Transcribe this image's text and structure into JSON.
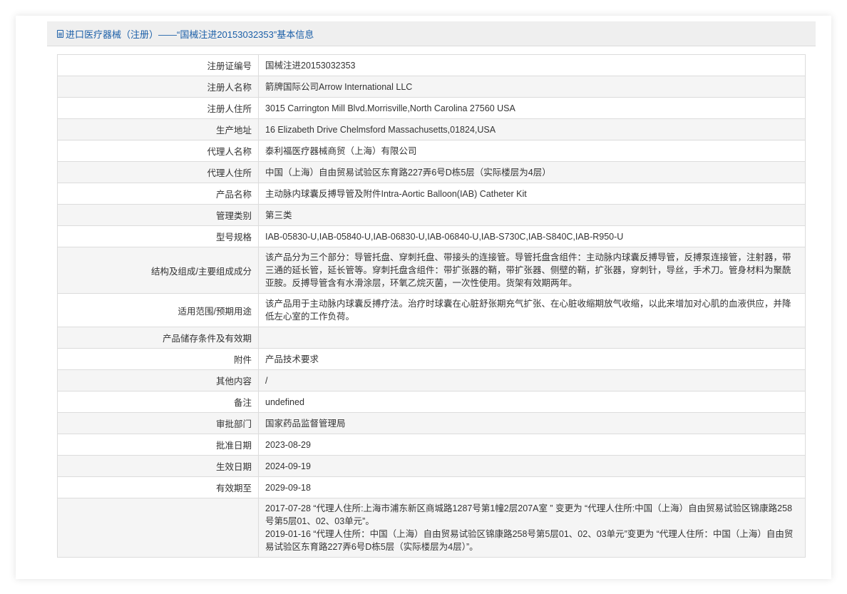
{
  "header": {
    "title": "进口医疗器械（注册）——“国械注进20153032353”基本信息",
    "icon": "document-icon"
  },
  "rows": [
    {
      "label": "注册证编号",
      "value": "国械注进20153032353"
    },
    {
      "label": "注册人名称",
      "value": "箭牌国际公司Arrow International LLC"
    },
    {
      "label": "注册人住所",
      "value": "3015 Carrington Mill Blvd.Morrisville,North Carolina 27560 USA"
    },
    {
      "label": "生产地址",
      "value": "16 Elizabeth Drive Chelmsford Massachusetts,01824,USA"
    },
    {
      "label": "代理人名称",
      "value": "泰利福医疗器械商贸（上海）有限公司"
    },
    {
      "label": "代理人住所",
      "value": "中国（上海）自由贸易试验区东育路227弄6号D栋5层（实际楼层为4层）"
    },
    {
      "label": "产品名称",
      "value": "主动脉内球囊反搏导管及附件Intra-Aortic Balloon(IAB) Catheter Kit"
    },
    {
      "label": "管理类别",
      "value": "第三类"
    },
    {
      "label": "型号规格",
      "value": "IAB-05830-U,IAB-05840-U,IAB-06830-U,IAB-06840-U,IAB-S730C,IAB-S840C,IAB-R950-U"
    },
    {
      "label": "结构及组成/主要组成成分",
      "value": "该产品分为三个部分：导管托盘、穿刺托盘、带接头的连接管。导管托盘含组件：主动脉内球囊反搏导管，反搏泵连接管，注射器，带三通的延长管，延长管等。穿刺托盘含组件：带扩张器的鞘，带扩张器、侧壁的鞘，扩张器，穿刺针，导丝，手术刀。管身材料为聚酰亚胺。反搏导管含有水滑涂层，环氧乙烷灭菌，一次性使用。货架有效期两年。"
    },
    {
      "label": "适用范围/预期用途",
      "value": "该产品用于主动脉内球囊反搏疗法。治疗时球囊在心脏舒张期充气扩张、在心脏收缩期放气收缩，以此来增加对心肌的血液供应，并降低左心室的工作负荷。"
    },
    {
      "label": "产品储存条件及有效期",
      "value": ""
    },
    {
      "label": "附件",
      "value": "产品技术要求"
    },
    {
      "label": "其他内容",
      "value": "/"
    },
    {
      "label": "备注",
      "value": "undefined"
    },
    {
      "label": "审批部门",
      "value": "国家药品监督管理局"
    },
    {
      "label": "批准日期",
      "value": "2023-08-29"
    },
    {
      "label": "生效日期",
      "value": "2024-09-19"
    },
    {
      "label": "有效期至",
      "value": "2029-09-18"
    }
  ],
  "change_history": {
    "label": "",
    "entries": [
      "2017-07-28 “代理人住所:上海市浦东新区商城路1287号第1幢2层207A室 ” 变更为 “代理人住所:中国（上海）自由贸易试验区锦康路258号第5层01、02、03单元”。",
      "2019-01-16 “代理人住所：中国（上海）自由贸易试验区锦康路258号第5层01、02、03单元”变更为 “代理人住所：中国（上海）自由贸易试验区东育路227弄6号D栋5层（实际楼层为4层）”。"
    ]
  }
}
